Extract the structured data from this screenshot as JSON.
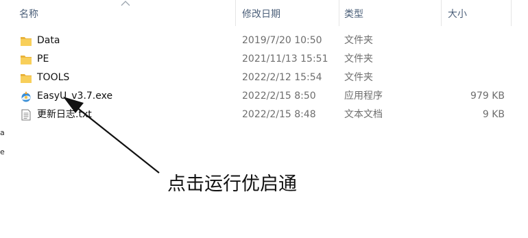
{
  "columns": {
    "name": "名称",
    "modified": "修改日期",
    "type": "类型",
    "size": "大小"
  },
  "files": [
    {
      "name": "Data",
      "modified": "2019/7/20 10:50",
      "type": "文件夹",
      "size": "",
      "icon": "folder-icon"
    },
    {
      "name": "PE",
      "modified": "2021/11/13 15:51",
      "type": "文件夹",
      "size": "",
      "icon": "folder-icon"
    },
    {
      "name": "TOOLS",
      "modified": "2022/2/12 15:54",
      "type": "文件夹",
      "size": "",
      "icon": "folder-icon"
    },
    {
      "name": "EasyU_v3.7.exe",
      "modified": "2022/2/15 8:50",
      "type": "应用程序",
      "size": "979 KB",
      "icon": "app-icon"
    },
    {
      "name": "更新日志.txt",
      "modified": "2022/2/15 8:48",
      "type": "文本文档",
      "size": "9 KB",
      "icon": "text-document-icon"
    }
  ],
  "annotation": {
    "text": "点击运行优启通"
  },
  "colors": {
    "folder": "#f4c44d",
    "header_text": "#4c607a",
    "secondary_text": "#6d6d6d"
  }
}
